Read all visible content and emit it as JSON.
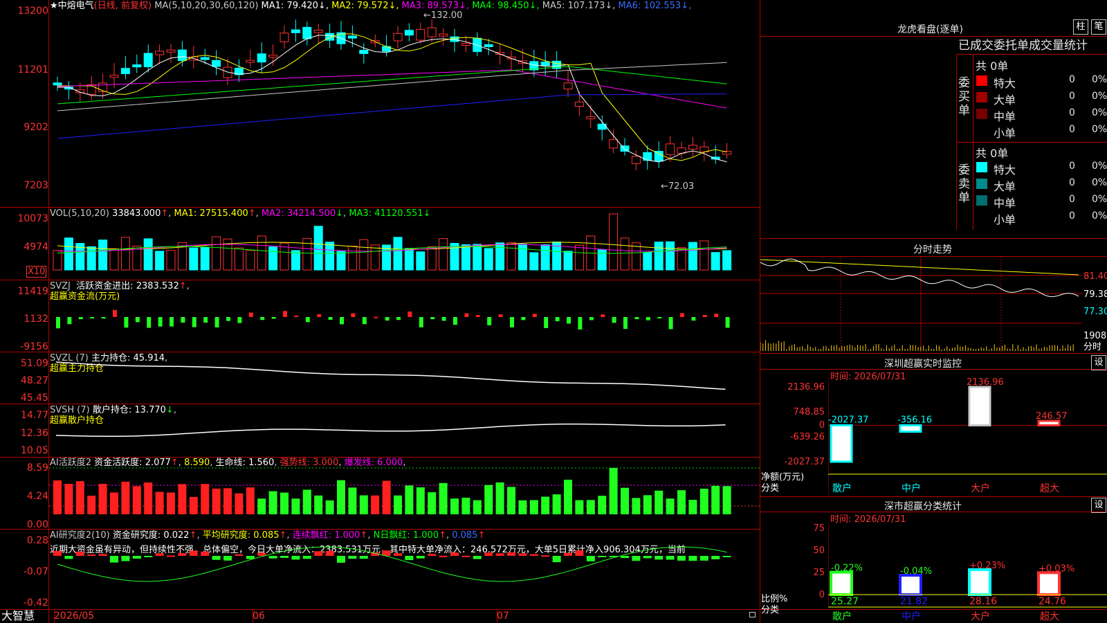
{
  "kline": {
    "stock_star": "★",
    "stock_name": "中熔电气",
    "period_note": "(日线, 前复权)",
    "ma_label": "MA(5,10,20,30,60,120)",
    "ma_values": [
      {
        "name": "MA1",
        "value": "79.420",
        "color": "#ffffff"
      },
      {
        "name": "MA2",
        "value": "79.572",
        "color": "#ffff00"
      },
      {
        "name": "MA3",
        "value": "89.573",
        "color": "#ff00ff"
      },
      {
        "name": "MA4",
        "value": "98.450",
        "color": "#00ff00"
      },
      {
        "name": "MA5",
        "value": "107.173",
        "color": "#c8c8c8"
      },
      {
        "name": "MA6",
        "value": "102.553",
        "color": "#3b6cff"
      }
    ],
    "y_labels": [
      "13200",
      "11201",
      "9202",
      "7203"
    ],
    "high_mark": "132.00",
    "low_mark": "72.03",
    "arrow_up": "↓",
    "arrow_down": "↓"
  },
  "vol": {
    "label": "VOL(5,10,20)",
    "value": "33843.000",
    "ma1": "27515.400",
    "ma2": "34214.500",
    "ma3": "41120.551",
    "y_labels": [
      "10073",
      "4974"
    ],
    "unit": "X10"
  },
  "svzj": {
    "label": "SVZJ",
    "title": "活跃资金进出:",
    "value": "2383.532",
    "sub": "超赢资金流(万元)",
    "y_labels": [
      "11419",
      "1132",
      "-9156"
    ]
  },
  "svzl": {
    "label": "SVZL (7)",
    "title": "主力持仓:",
    "value": "45.914",
    "sub": "超赢主力持仓",
    "y_labels": [
      "51.09",
      "48.27",
      "45.45"
    ]
  },
  "svsh": {
    "label": "SVSH (7)",
    "title": "散户持仓:",
    "value": "13.770",
    "sub": "超赢散户持仓",
    "y_labels": [
      "14.77",
      "12.36",
      "10.05"
    ]
  },
  "ai_active": {
    "label": "AI活跃度2",
    "title": "资金活跃度:",
    "value": "2.077",
    "v2": "8.590",
    "life_label": "生命线:",
    "life": "1.560",
    "strong_label": "强势线:",
    "strong": "3.000",
    "burst_label": "爆发线:",
    "burst": "6.000",
    "y_labels": [
      "8.59",
      "4.24",
      "0.00"
    ]
  },
  "ai_research": {
    "label": "AI研究度2(10)",
    "title": "资金研究度:",
    "value": "0.022",
    "avg_label": "平均研究度:",
    "avg": "0.085",
    "cont_label": "连续飘红:",
    "cont": "1.000",
    "n_label": "N日飘红:",
    "n": "1.000",
    "last": "0.085",
    "text": "近期大资金虽有异动，但持续性不强，总体偏空，今日大单净流入：2383.531万元，其中特大单净流入：246.572万元，大单5日累计净入906.304万元，当前",
    "y_labels": [
      "0.28",
      "-0.07",
      "-0.42"
    ]
  },
  "bottom": {
    "brand": "大智慧",
    "dates": [
      "2026/05",
      "06",
      "07"
    ]
  },
  "dragon": {
    "title": "龙虎看盘(逐单)",
    "btn1": "柱",
    "btn2": "笔",
    "tabs": "已成交委托单成交量统计",
    "buy_side": "委买单",
    "sell_side": "委卖单",
    "buy_total": "共 0单",
    "sell_total": "共 0单",
    "buy_rows": [
      {
        "label": "特大",
        "count": "0",
        "pct": "0%",
        "color": "#ff0000"
      },
      {
        "label": "大单",
        "count": "0",
        "pct": "0%",
        "color": "#a00000"
      },
      {
        "label": "中单",
        "count": "0",
        "pct": "0%",
        "color": "#780000"
      },
      {
        "label": "小单",
        "count": "0",
        "pct": "0%",
        "color": "#000000"
      }
    ],
    "sell_rows": [
      {
        "label": "特大",
        "count": "0",
        "pct": "0%",
        "color": "#00ffff"
      },
      {
        "label": "大单",
        "count": "0",
        "pct": "0%",
        "color": "#008c8c"
      },
      {
        "label": "中单",
        "count": "0",
        "pct": "0%",
        "color": "#006e6e"
      },
      {
        "label": "小单",
        "count": "0",
        "pct": "0%",
        "color": "#000000"
      }
    ]
  },
  "intraday": {
    "title": "分时走势",
    "labels": [
      "81.40",
      "79.38",
      "77.30"
    ],
    "vol_label": "1908",
    "unit": "分时"
  },
  "monitor": {
    "title": "深圳超赢实时监控",
    "btn": "设",
    "time": "时间: 2026/07/31",
    "y_labels": [
      "2136.96",
      "748.85",
      "0",
      "-639.26",
      "-2027.37"
    ],
    "unit": "净额(万元)",
    "cat_label": "分类",
    "chart_data": {
      "type": "bar",
      "categories": [
        "散户",
        "中户",
        "大户",
        "超大"
      ],
      "values": [
        -2027.37,
        -356.16,
        2136.96,
        246.57
      ],
      "value_labels": [
        "-2027.37",
        "-356.16",
        "2136.96",
        "246.57"
      ],
      "ylim": [
        -2027.37,
        2136.96
      ],
      "ylabel": "净额(万元)",
      "xlabel": "分类"
    }
  },
  "classify": {
    "title": "深市超赢分类统计",
    "btn": "设",
    "time": "时间: 2026/07/31",
    "y_labels": [
      "75",
      "50",
      "25",
      "0"
    ],
    "unit": "比例%",
    "cat_label": "分类",
    "chart_data": {
      "type": "bar",
      "categories": [
        "散户",
        "中户",
        "大户",
        "超大"
      ],
      "values": [
        25.27,
        21.82,
        28.16,
        24.76
      ],
      "changes": [
        "-0.22%",
        "-0.04%",
        "+0.23%",
        "+0.03%"
      ],
      "value_labels": [
        "25.27",
        "21.82",
        "28.16",
        "24.76"
      ],
      "ylim": [
        0,
        75
      ],
      "ylabel": "比例%",
      "xlabel": "分类"
    }
  }
}
